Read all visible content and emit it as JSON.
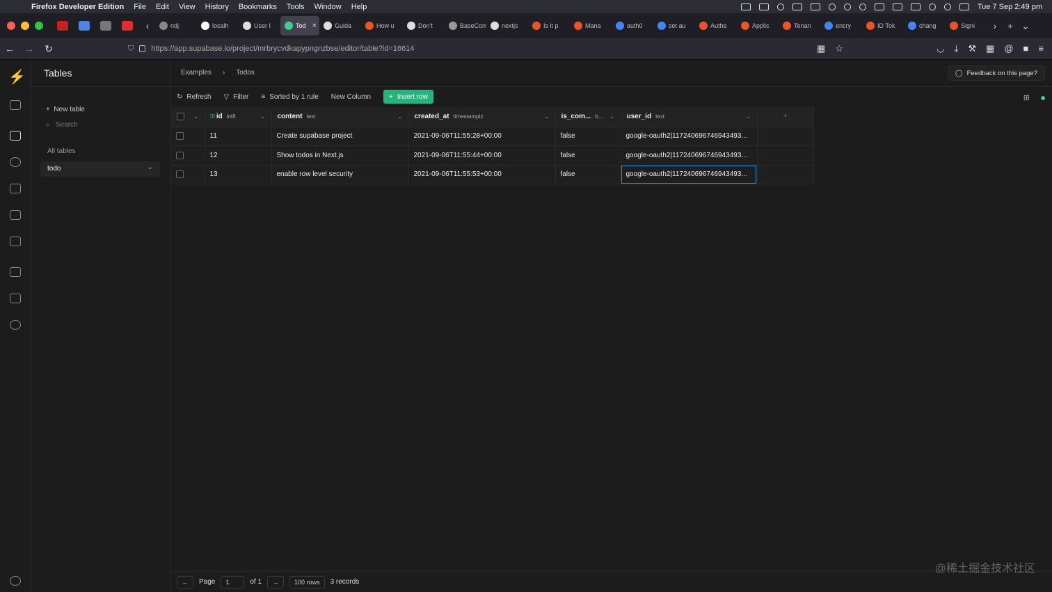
{
  "mac": {
    "app_name": "Firefox Developer Edition",
    "menus": [
      "File",
      "Edit",
      "View",
      "History",
      "Bookmarks",
      "Tools",
      "Window",
      "Help"
    ],
    "clock": "Tue 7 Sep  2:49 pm"
  },
  "tabs": [
    {
      "label": "ndj"
    },
    {
      "label": "localh"
    },
    {
      "label": "User I"
    },
    {
      "label": "Tod",
      "active": true
    },
    {
      "label": "Guida"
    },
    {
      "label": "How u"
    },
    {
      "label": "Don't"
    },
    {
      "label": "BaseConf"
    },
    {
      "label": "nextjs"
    },
    {
      "label": "Is it p"
    },
    {
      "label": "Mana"
    },
    {
      "label": "auth0"
    },
    {
      "label": "set au"
    },
    {
      "label": "Authe"
    },
    {
      "label": "Applic"
    },
    {
      "label": "Tenan"
    },
    {
      "label": "encry"
    },
    {
      "label": "ID Tok"
    },
    {
      "label": "chang"
    },
    {
      "label": "Signi"
    }
  ],
  "browser": {
    "url": "https://app.supabase.io/project/mrbrycvdkapypngnzbse/editor/table?id=16614"
  },
  "sidebar": {
    "title": "Tables",
    "new_table": "New table",
    "search_placeholder": "Search",
    "all_tables": "All tables",
    "selected_table": "todo"
  },
  "header": {
    "crumb_1": "Examples",
    "crumb_sep": "›",
    "crumb_2": "Todos",
    "feedback": "Feedback on this page?"
  },
  "toolbar": {
    "refresh": "Refresh",
    "filter": "Filter",
    "sorted": "Sorted by 1 rule",
    "new_column": "New Column",
    "insert_row": "Insert row"
  },
  "table": {
    "columns": [
      {
        "name": "id",
        "type": "int8"
      },
      {
        "name": "content",
        "type": "text"
      },
      {
        "name": "created_at",
        "type": "timestamptz"
      },
      {
        "name": "is_com...",
        "type": "b..."
      },
      {
        "name": "user_id",
        "type": "text"
      }
    ],
    "rows": [
      {
        "id": "11",
        "content": "Create supabase project",
        "created_at": "2021-09-06T11:55:28+00:00",
        "is_complete": "false",
        "user_id": "google-oauth2|117240696746943493..."
      },
      {
        "id": "12",
        "content": "Show todos in Next.js",
        "created_at": "2021-09-06T11:55:44+00:00",
        "is_complete": "false",
        "user_id": "google-oauth2|117240696746943493..."
      },
      {
        "id": "13",
        "content": "enable row level security",
        "created_at": "2021-09-06T11:55:53+00:00",
        "is_complete": "false",
        "user_id": "google-oauth2|117240696746943493..."
      }
    ]
  },
  "footer": {
    "page_label": "Page",
    "page_value": "1",
    "of_label": "of 1",
    "rows_select": "100 rows",
    "records": "3 records"
  },
  "watermark": "@稀土掘金技术社区",
  "colors": {
    "accent": "#3ecf8e",
    "insert_button": "#24b47e",
    "selection": "#2d8cd6"
  }
}
